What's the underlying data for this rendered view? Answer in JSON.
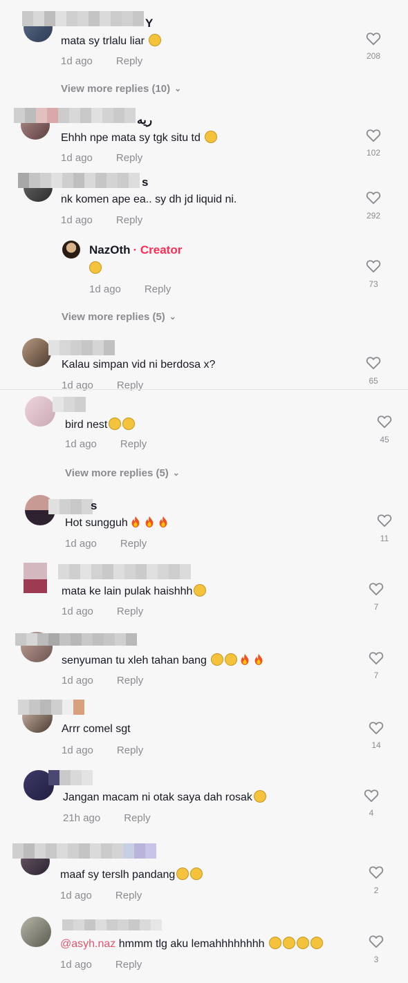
{
  "comments": [
    {
      "username_suffix": "Y",
      "text": "mata sy trlalu liar",
      "emoji": [
        "joy"
      ],
      "time": "1d ago",
      "reply": "Reply",
      "likes": "208",
      "more": "View more replies (10)"
    },
    {
      "username_suffix": "ريه",
      "text": "Ehhh npe mata sy tgk situ td",
      "emoji": [
        "flushed"
      ],
      "time": "1d ago",
      "reply": "Reply",
      "likes": "102"
    },
    {
      "username_suffix": "s",
      "text": "nk komen ape ea.. sy dh jd liquid ni.",
      "emoji": [],
      "time": "1d ago",
      "reply": "Reply",
      "likes": "292"
    },
    {
      "creator_name": "NazOth",
      "creator_tag": "· Creator",
      "emoji": [
        "flushed"
      ],
      "time": "1d ago",
      "reply": "Reply",
      "likes": "73",
      "more": "View more replies (5)"
    },
    {
      "text": "Kalau simpan vid ni berdosa x?",
      "emoji": [],
      "time": "1d ago",
      "reply": "Reply",
      "likes": "65"
    },
    {
      "text": "bird nest",
      "emoji": [
        "smirk",
        "smirk"
      ],
      "time": "1d ago",
      "reply": "Reply",
      "likes": "45",
      "more": "View more replies (5)"
    },
    {
      "username_suffix": "s",
      "text": "Hot sungguh",
      "emoji": [
        "fire",
        "fire",
        "fire"
      ],
      "time": "1d ago",
      "reply": "Reply",
      "likes": "11"
    },
    {
      "text": "mata ke lain pulak haishhh",
      "emoji": [
        "flushed"
      ],
      "time": "1d ago",
      "reply": "Reply",
      "likes": "7"
    },
    {
      "text": "senyuman tu xleh tahan bang",
      "emoji": [
        "joy",
        "joy",
        "fire",
        "fire"
      ],
      "time": "1d ago",
      "reply": "Reply",
      "likes": "7"
    },
    {
      "text": "Arrr comel sgt",
      "emoji": [],
      "time": "1d ago",
      "reply": "Reply",
      "likes": "14"
    },
    {
      "text": "Jangan macam ni otak saya dah rosak",
      "emoji": [
        "confused"
      ],
      "time": "21h ago",
      "reply": "Reply",
      "likes": "4"
    },
    {
      "text": "maaf sy terslh pandang",
      "emoji": [
        "rofl",
        "rofl"
      ],
      "time": "1d ago",
      "reply": "Reply",
      "likes": "2"
    },
    {
      "mention": "@asyh.naz",
      "text": " hmmm tlg aku lemahhhhhhhh",
      "emoji": [
        "weary",
        "weary",
        "weary",
        "weary"
      ],
      "time": "1d ago",
      "reply": "Reply",
      "likes": "3"
    }
  ],
  "colors": {
    "creator": "#fe2c55",
    "mention": "#e0566e",
    "meta": "#8a8b91",
    "background": "#f7f7f7"
  },
  "icons": {
    "like": "heart-outline-icon",
    "expand": "chevron-down-icon"
  }
}
